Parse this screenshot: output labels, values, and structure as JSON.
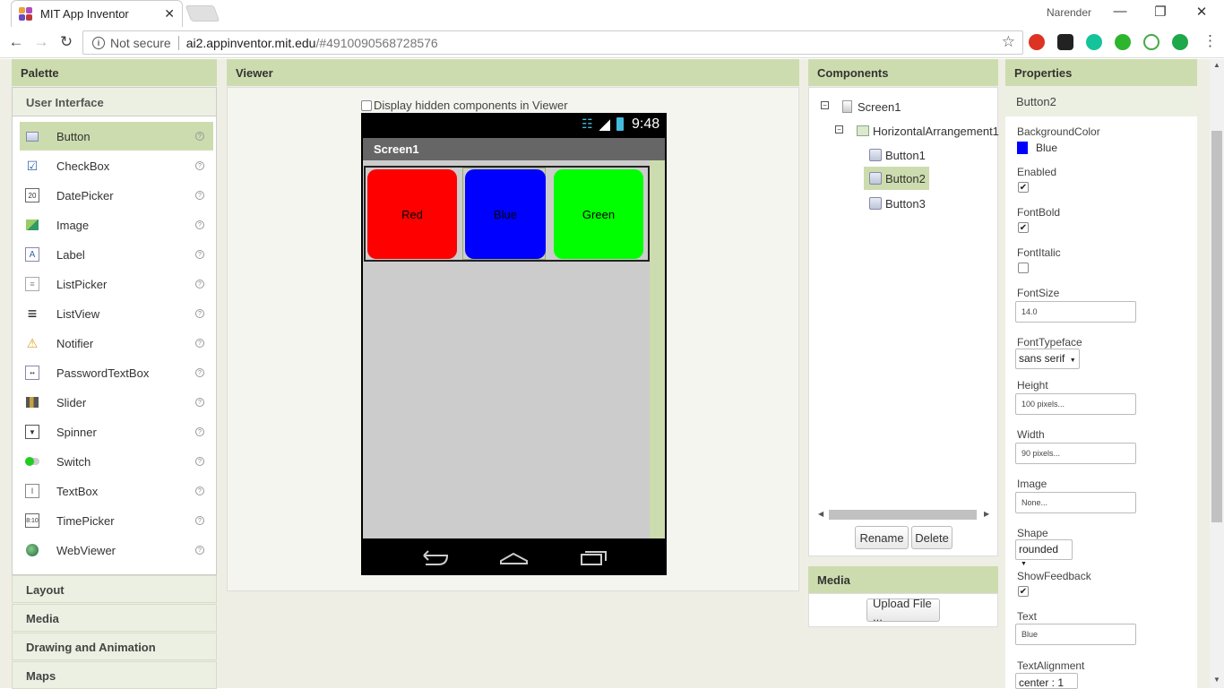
{
  "browser": {
    "tab_title": "MIT App Inventor",
    "tab_close": "✕",
    "user_name": "Narender",
    "not_secure": "Not secure",
    "url_host": "ai2.appinventor.mit.edu",
    "url_path": "/#4910090568728576"
  },
  "palette": {
    "title": "Palette",
    "category": "User Interface",
    "items": [
      {
        "label": "Button",
        "icon": "button-icon"
      },
      {
        "label": "CheckBox",
        "icon": "checkbox-icon"
      },
      {
        "label": "DatePicker",
        "icon": "datepicker-icon"
      },
      {
        "label": "Image",
        "icon": "image-icon"
      },
      {
        "label": "Label",
        "icon": "label-icon"
      },
      {
        "label": "ListPicker",
        "icon": "listpicker-icon"
      },
      {
        "label": "ListView",
        "icon": "listview-icon"
      },
      {
        "label": "Notifier",
        "icon": "notifier-icon"
      },
      {
        "label": "PasswordTextBox",
        "icon": "password-icon"
      },
      {
        "label": "Slider",
        "icon": "slider-icon"
      },
      {
        "label": "Spinner",
        "icon": "spinner-icon"
      },
      {
        "label": "Switch",
        "icon": "switch-icon"
      },
      {
        "label": "TextBox",
        "icon": "textbox-icon"
      },
      {
        "label": "TimePicker",
        "icon": "timepicker-icon"
      },
      {
        "label": "WebViewer",
        "icon": "webviewer-icon"
      }
    ],
    "help": "?",
    "sections": [
      "Layout",
      "Media",
      "Drawing and Animation",
      "Maps"
    ]
  },
  "viewer": {
    "title": "Viewer",
    "hidden_label": "Display hidden components in Viewer",
    "time": "9:48",
    "screen_title": "Screen1",
    "buttons": [
      {
        "label": "Red",
        "color": "#ff0000"
      },
      {
        "label": "Blue",
        "color": "#0000ff"
      },
      {
        "label": "Green",
        "color": "#00ff00"
      }
    ]
  },
  "components": {
    "title": "Components",
    "tree": {
      "screen": "Screen1",
      "arrangement": "HorizontalArrangement1",
      "buttons": [
        "Button1",
        "Button2",
        "Button3"
      ]
    },
    "rename": "Rename",
    "delete": "Delete"
  },
  "media": {
    "title": "Media",
    "upload": "Upload File ..."
  },
  "properties": {
    "title": "Properties",
    "selected": "Button2",
    "background_color": {
      "label": "BackgroundColor",
      "value": "Blue",
      "swatch": "#0000ff"
    },
    "enabled": {
      "label": "Enabled",
      "checked": true
    },
    "font_bold": {
      "label": "FontBold",
      "checked": true
    },
    "font_italic": {
      "label": "FontItalic",
      "checked": false
    },
    "font_size": {
      "label": "FontSize",
      "value": "14.0"
    },
    "font_typeface": {
      "label": "FontTypeface",
      "value": "sans serif"
    },
    "height": {
      "label": "Height",
      "value": "100 pixels..."
    },
    "width": {
      "label": "Width",
      "value": "90 pixels..."
    },
    "image": {
      "label": "Image",
      "value": "None..."
    },
    "shape": {
      "label": "Shape",
      "value": "rounded"
    },
    "show_feedback": {
      "label": "ShowFeedback",
      "checked": true
    },
    "text": {
      "label": "Text",
      "value": "Blue"
    },
    "text_alignment": {
      "label": "TextAlignment",
      "value": "center : 1"
    }
  },
  "colors": {
    "panel_header": "#cddcae",
    "selection": "#cddcae"
  }
}
